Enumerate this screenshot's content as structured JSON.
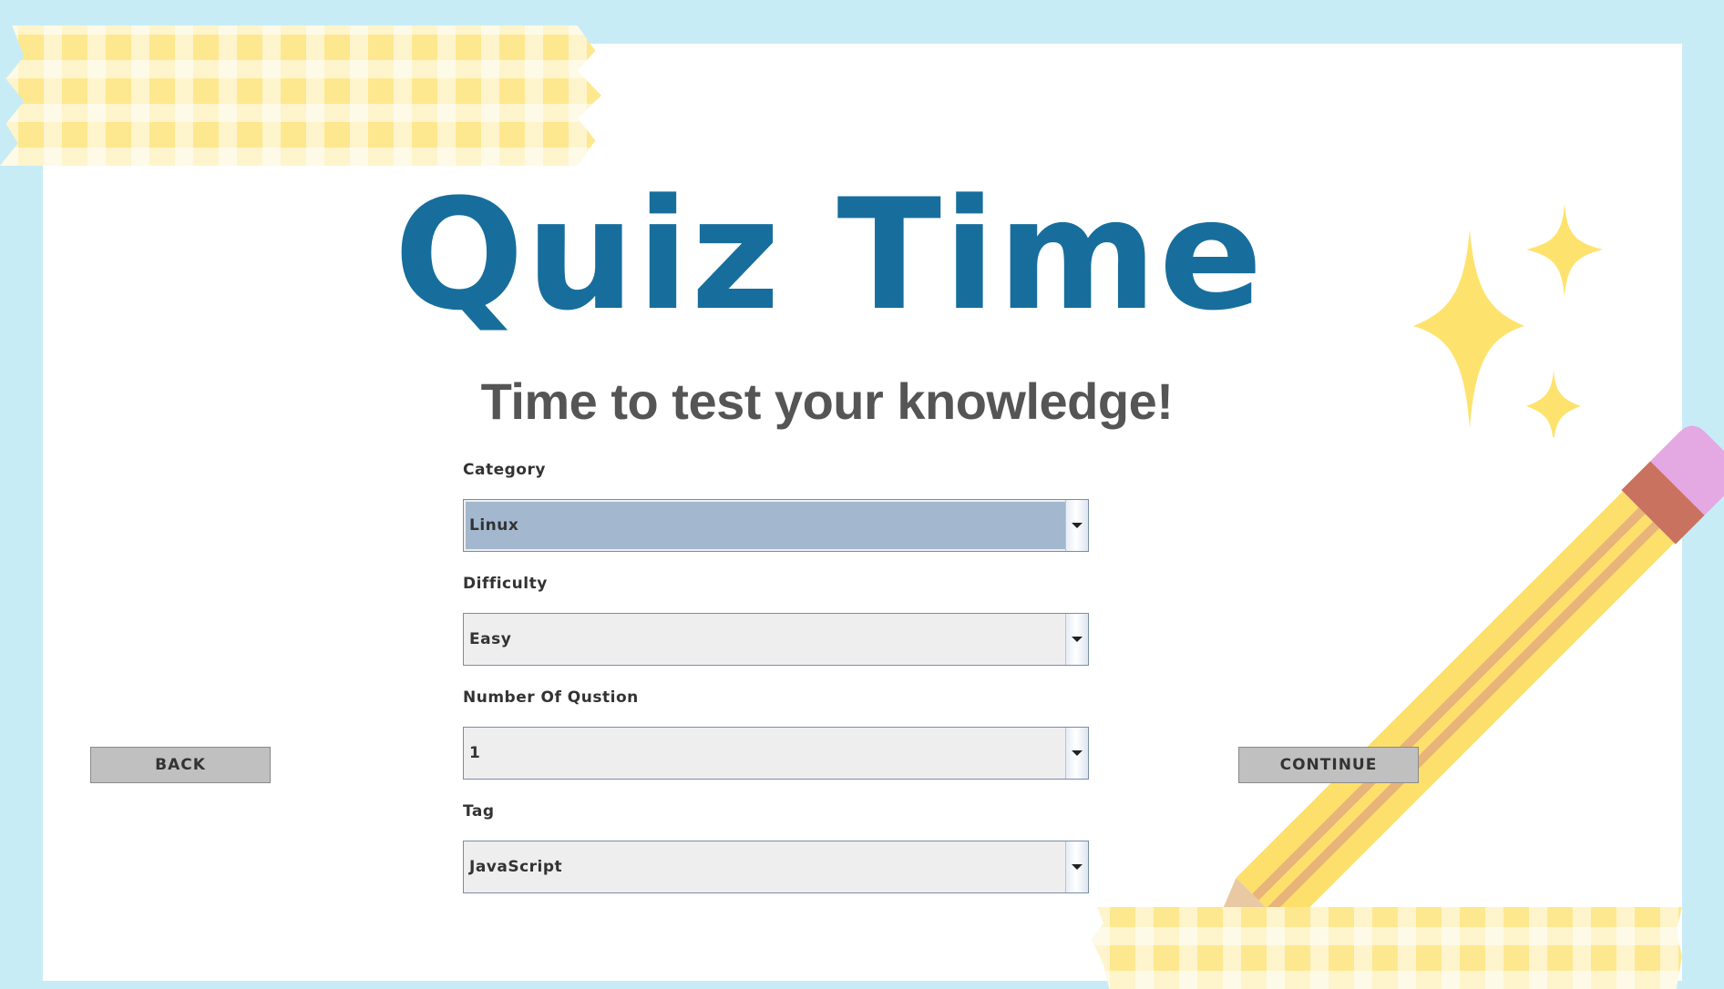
{
  "app": {
    "title": "Quiz Time",
    "subtitle": "Time to test your knowledge!"
  },
  "form": {
    "fields": [
      {
        "label": "Category",
        "value": "Linux",
        "selected": true
      },
      {
        "label": "Difficulty",
        "value": "Easy",
        "selected": false
      },
      {
        "label": "Number Of Qustion",
        "value": "1",
        "selected": false
      },
      {
        "label": "Tag",
        "value": "JavaScript",
        "selected": false
      }
    ]
  },
  "buttons": {
    "back": "BACK",
    "continue": "CONTINUE"
  },
  "decorations": {
    "icons": [
      "washi-tape-top",
      "washi-tape-bottom",
      "sparkle-icon",
      "pencil-icon"
    ],
    "colors": {
      "background": "#c8ecf6",
      "paper": "#ffffff",
      "title": "#176e9c",
      "subtitle": "#555555",
      "tape": "#fde88f",
      "sparkle": "#fde36d",
      "pencil_body": "#fde06b",
      "pencil_stripe": "#e8b47a",
      "pencil_band": "#c97260",
      "pencil_eraser": "#e4a8e2",
      "pencil_wood": "#e8c9a3",
      "selection": "#a3b8cf",
      "button": "#c0c0c0"
    }
  }
}
